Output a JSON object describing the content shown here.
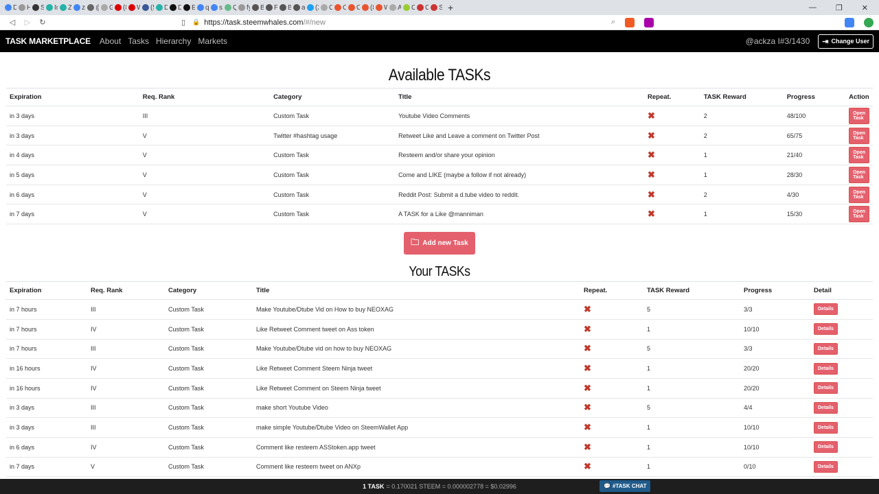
{
  "browser": {
    "tabs": [
      {
        "label": "D",
        "color": "#4285f4"
      },
      {
        "label": "H",
        "color": "#999"
      },
      {
        "label": "St",
        "color": "#333"
      },
      {
        "label": "In",
        "color": "#25b3a8"
      },
      {
        "label": "Zo",
        "color": "#25b3a8"
      },
      {
        "label": "zz",
        "color": "#4285f4"
      },
      {
        "label": "@",
        "color": "#666"
      },
      {
        "label": "G",
        "color": "#aaa"
      },
      {
        "label": "(8",
        "color": "#d00"
      },
      {
        "label": "W",
        "color": "#d00"
      },
      {
        "label": "(5",
        "color": "#3b5998"
      },
      {
        "label": "D",
        "color": "#25b3a8"
      },
      {
        "label": "D",
        "color": "#111"
      },
      {
        "label": "Er",
        "color": "#111"
      },
      {
        "label": "q",
        "color": "#4285f4"
      },
      {
        "label": "sr",
        "color": "#4285f4"
      },
      {
        "label": "Q",
        "color": "#6b8"
      },
      {
        "label": "fy",
        "color": "#999"
      },
      {
        "label": "Bl",
        "color": "#555"
      },
      {
        "label": "Pi",
        "color": "#555"
      },
      {
        "label": "Bl",
        "color": "#555"
      },
      {
        "label": "at",
        "color": "#555"
      },
      {
        "label": "(2",
        "color": "#1da1f2"
      },
      {
        "label": "C",
        "color": "#aaa"
      },
      {
        "label": "C",
        "color": "#e8542f"
      },
      {
        "label": "C",
        "color": "#e8542f"
      },
      {
        "label": "(8",
        "color": "#e8542f"
      },
      {
        "label": "W",
        "color": "#e8542f"
      },
      {
        "label": "A",
        "color": "#aaa"
      },
      {
        "label": "C",
        "color": "#9c3"
      },
      {
        "label": "C",
        "color": "#c33"
      },
      {
        "label": "Si",
        "color": "#c33"
      }
    ],
    "url_host": "https://task.steemwhales.com",
    "url_path": "/#/new"
  },
  "nav": {
    "brand": "TASK MARKETPLACE",
    "links": [
      "About",
      "Tasks",
      "Hierarchy",
      "Markets"
    ],
    "user": "@ackza I#3/1430",
    "change_user": "Change User"
  },
  "available": {
    "title": "Available TASKs",
    "headers": [
      "Expiration",
      "Req. Rank",
      "Category",
      "Title",
      "Repeat.",
      "TASK Reward",
      "Progress",
      "Action"
    ],
    "rows": [
      {
        "expiration": "in 3 days",
        "rank": "III",
        "category": "Custom Task",
        "title": "Youtube Video Comments",
        "reward": "2",
        "progress": "48/100",
        "action": "Open Task"
      },
      {
        "expiration": "in 3 days",
        "rank": "V",
        "category": "Twitter #hashtag usage",
        "title": "Retweet Like and Leave a comment on Twitter Post",
        "reward": "2",
        "progress": "65/75",
        "action": "Open Task"
      },
      {
        "expiration": "in 4 days",
        "rank": "V",
        "category": "Custom Task",
        "title": "Resteem and/or share your opinion",
        "reward": "1",
        "progress": "21/40",
        "action": "Open Task"
      },
      {
        "expiration": "in 5 days",
        "rank": "V",
        "category": "Custom Task",
        "title": "Come and LIKE (maybe a follow if not already)",
        "reward": "1",
        "progress": "28/30",
        "action": "Open Task"
      },
      {
        "expiration": "in 6 days",
        "rank": "V",
        "category": "Custom Task",
        "title": "Reddit Post: Submit a d.tube video to reddit.",
        "reward": "2",
        "progress": "4/30",
        "action": "Open Task"
      },
      {
        "expiration": "in 7 days",
        "rank": "V",
        "category": "Custom Task",
        "title": "A TASK for a Like @manniman",
        "reward": "1",
        "progress": "15/30",
        "action": "Open Task"
      }
    ],
    "add_button": "Add new Task"
  },
  "yours": {
    "title": "Your TASKs",
    "headers": [
      "Expiration",
      "Req. Rank",
      "Category",
      "Title",
      "Repeat.",
      "TASK Reward",
      "Progress",
      "Detail"
    ],
    "rows": [
      {
        "expiration": "in 7 hours",
        "rank": "III",
        "category": "Custom Task",
        "title": "Make Youtube/Dtube Vid on How to buy NEOXAG",
        "reward": "5",
        "progress": "3/3",
        "action": "Details"
      },
      {
        "expiration": "in 7 hours",
        "rank": "IV",
        "category": "Custom Task",
        "title": "Like Retweet Comment tweet on Ass token",
        "reward": "1",
        "progress": "10/10",
        "action": "Details"
      },
      {
        "expiration": "in 7 hours",
        "rank": "III",
        "category": "Custom Task",
        "title": "Make Youtube/Dtube vid on how to buy NEOXAG",
        "reward": "5",
        "progress": "3/3",
        "action": "Details"
      },
      {
        "expiration": "in 16 hours",
        "rank": "IV",
        "category": "Custom Task",
        "title": "Like Retweet Comment Steem Ninja tweet",
        "reward": "1",
        "progress": "20/20",
        "action": "Details"
      },
      {
        "expiration": "in 16 hours",
        "rank": "IV",
        "category": "Custom Task",
        "title": "Like Retweet Comment on Steem Ninja tweet",
        "reward": "1",
        "progress": "20/20",
        "action": "Details"
      },
      {
        "expiration": "in 3 days",
        "rank": "III",
        "category": "Custom Task",
        "title": "make short Youtube Video",
        "reward": "5",
        "progress": "4/4",
        "action": "Details"
      },
      {
        "expiration": "in 3 days",
        "rank": "III",
        "category": "Custom Task",
        "title": "make simple Youtube/Dtube Video on SteemWallet App",
        "reward": "1",
        "progress": "10/10",
        "action": "Details"
      },
      {
        "expiration": "in 6 days",
        "rank": "IV",
        "category": "Custom Task",
        "title": "Comment like resteem ASStoken.app tweet",
        "reward": "1",
        "progress": "10/10",
        "action": "Details"
      },
      {
        "expiration": "in 7 days",
        "rank": "V",
        "category": "Custom Task",
        "title": "Comment like resteem tweet on ANXp",
        "reward": "1",
        "progress": "0/10",
        "action": "Details"
      }
    ]
  },
  "footer": {
    "label": "1 TASK",
    "rate": "= 0.170021 STEEM = 0.000002778 = $0.02996",
    "chat": "#TASK CHAT"
  },
  "colors": {
    "accent": "#e4606d",
    "nav_bg": "#000000",
    "repeat_x": "#c0392b",
    "chat": "#1f5a8a"
  }
}
